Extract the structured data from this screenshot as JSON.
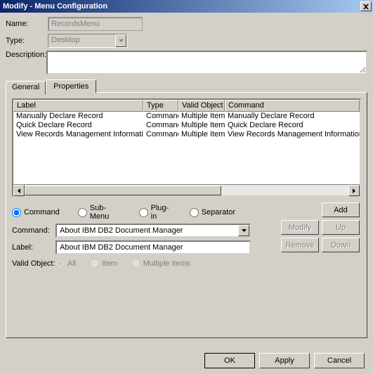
{
  "title": "Modify - Menu Configuration",
  "fields": {
    "name_label": "Name:",
    "name_value": "RecordsMenu",
    "type_label": "Type:",
    "type_value": "Desktop",
    "desc_label": "Description:"
  },
  "tabs": {
    "general": "General",
    "properties": "Properties"
  },
  "grid": {
    "headers": {
      "label": "Label",
      "type": "Type",
      "valid": "Valid Object",
      "command": "Command"
    },
    "rows": [
      {
        "label": "Manually Declare Record",
        "type": "Command",
        "valid": "Multiple Items",
        "command": "Manually Declare Record"
      },
      {
        "label": "Quick Declare Record",
        "type": "Command",
        "valid": "Multiple Items",
        "command": "Quick Declare Record"
      },
      {
        "label": "View Records Management Information",
        "type": "Command",
        "valid": "Multiple Items",
        "command": "View Records Management Information"
      }
    ]
  },
  "radios": {
    "mode": {
      "command": "Command",
      "submenu": "Sub-Menu",
      "plugin": "Plug-in",
      "separator": "Separator"
    },
    "valid": {
      "all": "All",
      "item": "Item",
      "multiple": "Multiple items"
    }
  },
  "detail": {
    "command_label": "Command:",
    "command_value": "About IBM DB2 Document Manager",
    "label_label": "Label:",
    "label_value": "About IBM DB2 Document Manager",
    "valid_label": "Valid Object:"
  },
  "buttons": {
    "add": "Add",
    "modify": "Modify",
    "up": "Up",
    "remove": "Remove",
    "down": "Down",
    "ok": "OK",
    "apply": "Apply",
    "cancel": "Cancel"
  }
}
